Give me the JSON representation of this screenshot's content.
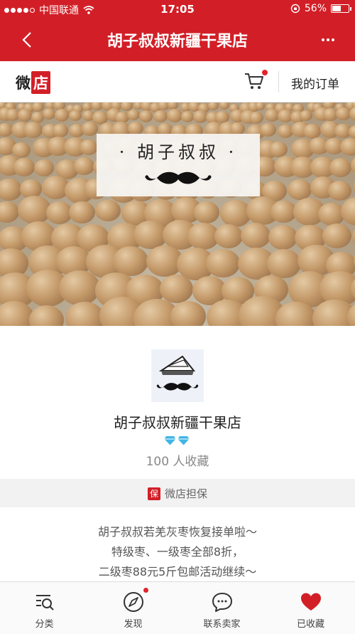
{
  "status_bar": {
    "carrier": "中国联通",
    "time": "17:05",
    "battery": "56%"
  },
  "nav": {
    "title": "胡子叔叔新疆干果店"
  },
  "header": {
    "logo_text_1": "微",
    "logo_text_2": "店",
    "orders_label": "我的订单"
  },
  "banner": {
    "sign_text": "· 胡子叔叔 ·"
  },
  "shop": {
    "name": "胡子叔叔新疆干果店",
    "favorites": "100 人收藏",
    "guarantee_badge": "保",
    "guarantee_label": "微店担保"
  },
  "notice": {
    "line1": "胡子叔叔若羌灰枣恢复接单啦～",
    "line2": "特级枣、一级枣全部8折，",
    "line3": "二级枣88元5斤包邮活动继续～"
  },
  "tabs": [
    {
      "label": "分类",
      "icon": "category-search-icon"
    },
    {
      "label": "发现",
      "icon": "compass-icon"
    },
    {
      "label": "联系卖家",
      "icon": "chat-icon"
    },
    {
      "label": "已收藏",
      "icon": "heart-icon"
    }
  ],
  "colors": {
    "brand_red": "#d21f27",
    "favorited_heart": "#d21f27",
    "diamond": "#3fb6e6"
  }
}
